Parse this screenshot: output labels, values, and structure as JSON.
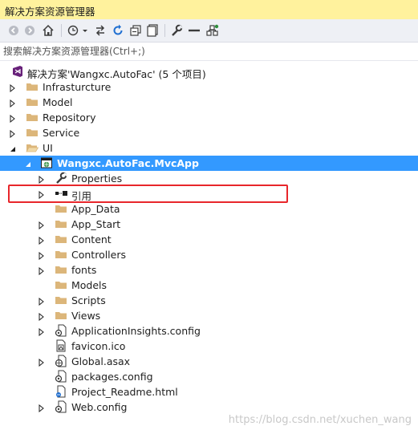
{
  "window": {
    "title": "解决方案资源管理器"
  },
  "toolbar": {
    "buttons": [
      "back-icon",
      "forward-icon",
      "home-icon",
      "history-icon",
      "sync-icon",
      "refresh-icon",
      "collapse-all-icon",
      "show-all-files-icon",
      "properties-icon",
      "preview-icon",
      "scope-icon"
    ]
  },
  "search": {
    "placeholder": "搜索解决方案资源管理器(Ctrl+;)"
  },
  "tree": {
    "solution": "解决方案'Wangxc.AutoFac' (5 个项目)",
    "items": [
      {
        "label": "Infrasturcture"
      },
      {
        "label": "Model"
      },
      {
        "label": "Repository"
      },
      {
        "label": "Service"
      },
      {
        "label": "UI"
      },
      {
        "label": "Wangxc.AutoFac.MvcApp"
      },
      {
        "label": "Properties"
      },
      {
        "label": "引用"
      },
      {
        "label": "App_Data"
      },
      {
        "label": "App_Start"
      },
      {
        "label": "Content"
      },
      {
        "label": "Controllers"
      },
      {
        "label": "fonts"
      },
      {
        "label": "Models"
      },
      {
        "label": "Scripts"
      },
      {
        "label": "Views"
      },
      {
        "label": "ApplicationInsights.config"
      },
      {
        "label": "favicon.ico"
      },
      {
        "label": "Global.asax"
      },
      {
        "label": "packages.config"
      },
      {
        "label": "Project_Readme.html"
      },
      {
        "label": "Web.config"
      }
    ]
  },
  "watermark": "https://blog.csdn.net/xuchen_wang",
  "colors": {
    "title_bg": "#fff29d",
    "selection": "#3399ff",
    "highlight_box": "#e8262b",
    "folder": "#dcb67a"
  }
}
